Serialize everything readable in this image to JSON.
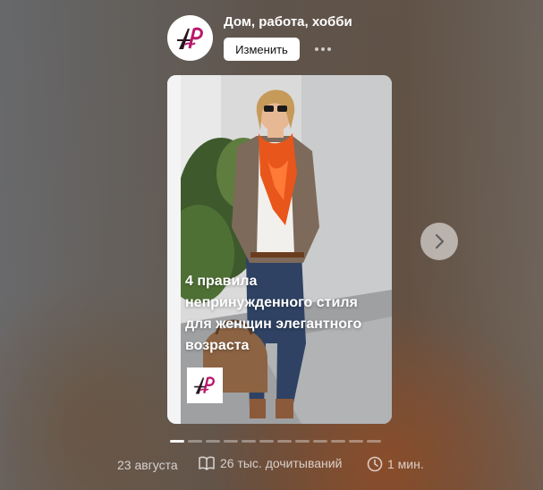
{
  "channel": {
    "name": "Дом, работа, хобби",
    "change_label": "Изменить",
    "more_label": "···",
    "logo_icon": "channel-logo-icon"
  },
  "story": {
    "title": "4 правила непринужденного стиля для женщин элегантного возраста",
    "image_icon": "woman-outfit-photo",
    "next_icon": "chevron-right-icon",
    "pages_total": 12,
    "page_current": 1
  },
  "meta": {
    "date": "23 августа",
    "reads": "26 тыс. дочитываний",
    "read_time": "1 мин.",
    "reads_icon": "book-icon",
    "time_icon": "clock-icon"
  },
  "colors": {
    "logo_pink": "#b8186b",
    "logo_dark": "#2a1520",
    "scarf_orange": "#e8561b"
  }
}
